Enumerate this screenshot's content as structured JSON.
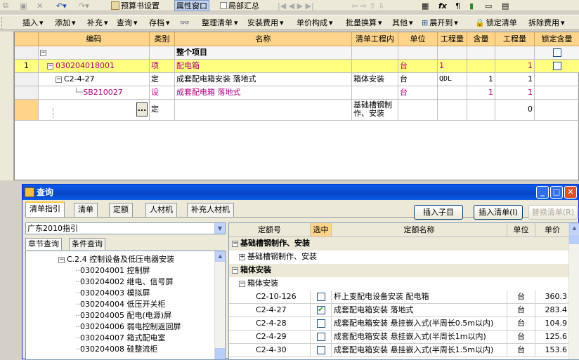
{
  "toolbar1": {
    "budget_settings": "预算书设置",
    "property_window": "属性窗口",
    "partial_summary": "局部汇总"
  },
  "toolbar2": {
    "insert": "插入",
    "add": "添加",
    "supplement": "补充",
    "query": "查询",
    "archive": "存档",
    "organize": "整理清单",
    "install_fee": "安装费用",
    "unit_price_composition": "单价构成",
    "batch_convert": "批量换算",
    "other": "其他",
    "expand_to": "展开到",
    "lock_list": "锁定清单",
    "split_fee": "拆除费用"
  },
  "grid": {
    "headers": [
      "编码",
      "类别",
      "名称",
      "清单工程内",
      "单位",
      "工程量",
      "含量",
      "工程量",
      "锁定含量"
    ],
    "rows": [
      {
        "rownum": "",
        "code": "",
        "type": "",
        "name": "整个项目",
        "content": "",
        "unit": "",
        "qty_expr": "",
        "ratio": "",
        "qty": ""
      },
      {
        "rownum": "1",
        "code": "030204018001",
        "type": "项",
        "name": "配电箱",
        "content": "",
        "unit": "台",
        "qty_expr": "1",
        "ratio": "",
        "qty": "1"
      },
      {
        "rownum": "",
        "code": "C2-4-27",
        "type": "定",
        "name": "成套配电箱安装 落地式",
        "content": "箱体安装",
        "unit": "台",
        "qty_expr": "QDL",
        "ratio": "1",
        "qty": "1"
      },
      {
        "rownum": "",
        "code": "SB210027",
        "type": "设",
        "name": "成套配电箱 落地式",
        "content": "",
        "unit": "台",
        "qty_expr": "",
        "ratio": "1",
        "qty": "1"
      },
      {
        "rownum": "",
        "code": "",
        "type": "定",
        "name": "",
        "content": "基础槽钢制作、安装",
        "unit": "",
        "qty_expr": "",
        "ratio": "",
        "qty": "0"
      }
    ],
    "ellipsis": "..."
  },
  "dialog": {
    "title": "查询",
    "tabs": [
      "清单指引",
      "清单",
      "定额",
      "人材机",
      "补充人材机"
    ],
    "insert_child": "插入子目",
    "insert_list": "插入清单(I)",
    "replace_list": "替换清单(R)",
    "guide_select": "广东2010指引",
    "subtabs": [
      "章节查询",
      "条件查询"
    ],
    "tree_section": "C.2.4 控制设备及低压电器安装",
    "tree_items": [
      {
        "code": "030204001",
        "name": "控制屏"
      },
      {
        "code": "030204002",
        "name": "继电、信号屏"
      },
      {
        "code": "030204003",
        "name": "模拟屏"
      },
      {
        "code": "030204004",
        "name": "低压开关柜"
      },
      {
        "code": "030204005",
        "name": "配电(电源)屏"
      },
      {
        "code": "030204006",
        "name": "弱电控制返回屏"
      },
      {
        "code": "030204007",
        "name": "箱式配电室"
      },
      {
        "code": "030204008",
        "name": "硅整流柜"
      }
    ],
    "right_headers": [
      "定额号",
      "选中",
      "定额名称",
      "单位",
      "单价"
    ],
    "groups": {
      "g1": "基础槽钢制作、安装",
      "g1_child": "基础槽钢制作、安装",
      "g2": "箱体安装",
      "g2_child": "箱体安装"
    },
    "quota_rows": [
      {
        "code": "C2-10-126",
        "checked": false,
        "name": "杆上变配电设备安装 配电箱",
        "unit": "台",
        "price": "360.3"
      },
      {
        "code": "C2-4-27",
        "checked": true,
        "name": "成套配电箱安装 落地式",
        "unit": "台",
        "price": "283.4"
      },
      {
        "code": "C2-4-28",
        "checked": false,
        "name": "成套配电箱安装 悬挂嵌入式(半周长0.5m以内)",
        "unit": "台",
        "price": "104.9"
      },
      {
        "code": "C2-4-29",
        "checked": false,
        "name": "成套配电箱安装 悬挂嵌入式(半周长1m以内)",
        "unit": "台",
        "price": "125.6"
      },
      {
        "code": "C2-4-30",
        "checked": false,
        "name": "成套配电箱安装 悬挂嵌入式(半周长1.5m以内)",
        "unit": "台",
        "price": "153.6"
      }
    ]
  }
}
